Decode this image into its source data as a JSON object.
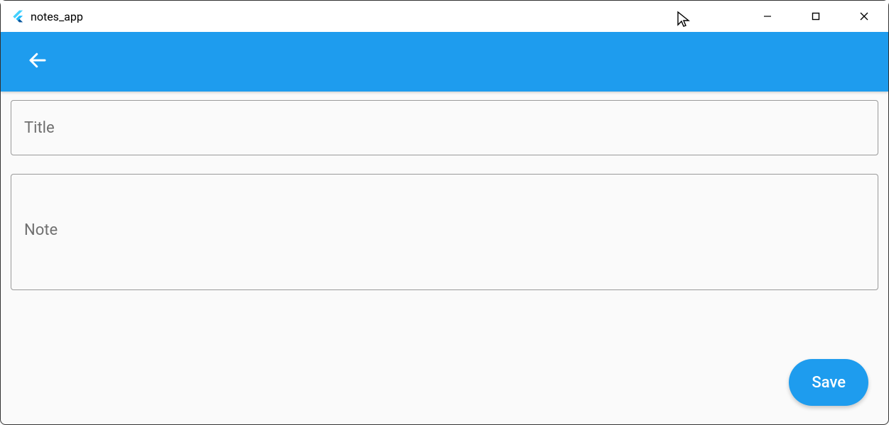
{
  "window": {
    "title": "notes_app"
  },
  "appbar": {
    "back_icon": "arrow_back"
  },
  "form": {
    "title": {
      "placeholder": "Title",
      "value": ""
    },
    "note": {
      "placeholder": "Note",
      "value": ""
    }
  },
  "fab": {
    "label": "Save"
  },
  "colors": {
    "primary": "#1e9cee",
    "background": "#fafafa"
  }
}
